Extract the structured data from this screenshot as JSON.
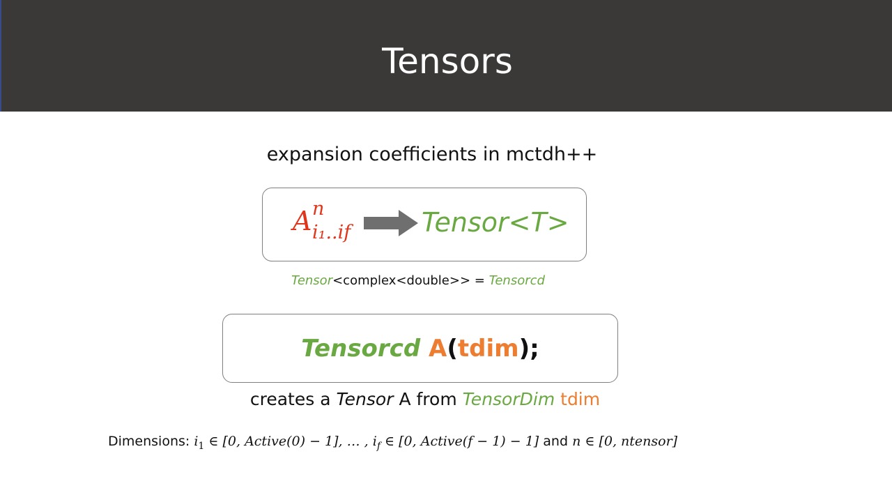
{
  "title": "Tensors",
  "subtitle": "expansion coefficients in mctdh++",
  "mapping": {
    "symbol_base": "A",
    "symbol_sup": "n",
    "symbol_sub": "i₁..if",
    "target": "Tensor<T>"
  },
  "typedef": {
    "lhs_type": "Tensor",
    "lhs_args": "<complex<double>> = ",
    "rhs": "Tensorcd"
  },
  "code": {
    "type": "Tensorcd",
    "var": "A",
    "open": "(",
    "arg": "tdim",
    "close": ");"
  },
  "creates": {
    "prefix": "creates a ",
    "tensor_word": "Tensor",
    "middle": " A from ",
    "dim_type": "TensorDim",
    "dim_var": "tdim"
  },
  "dimensions": {
    "label": "Dimensions: ",
    "i1": "i",
    "i1_sub": "1",
    "range1": " ∈ [0, Active(0) − 1], … , ",
    "if": "i",
    "if_sub": "f",
    "range2": " ∈ [0, Active(f − 1) − 1]",
    "and": " and ",
    "n": "n",
    "range3": " ∈ [0, ntensor]"
  },
  "colors": {
    "title_bar": "#3b3938",
    "green": "#6aa842",
    "orange": "#ec7d31",
    "red": "#e0341b",
    "arrow": "#6f6f6f"
  }
}
